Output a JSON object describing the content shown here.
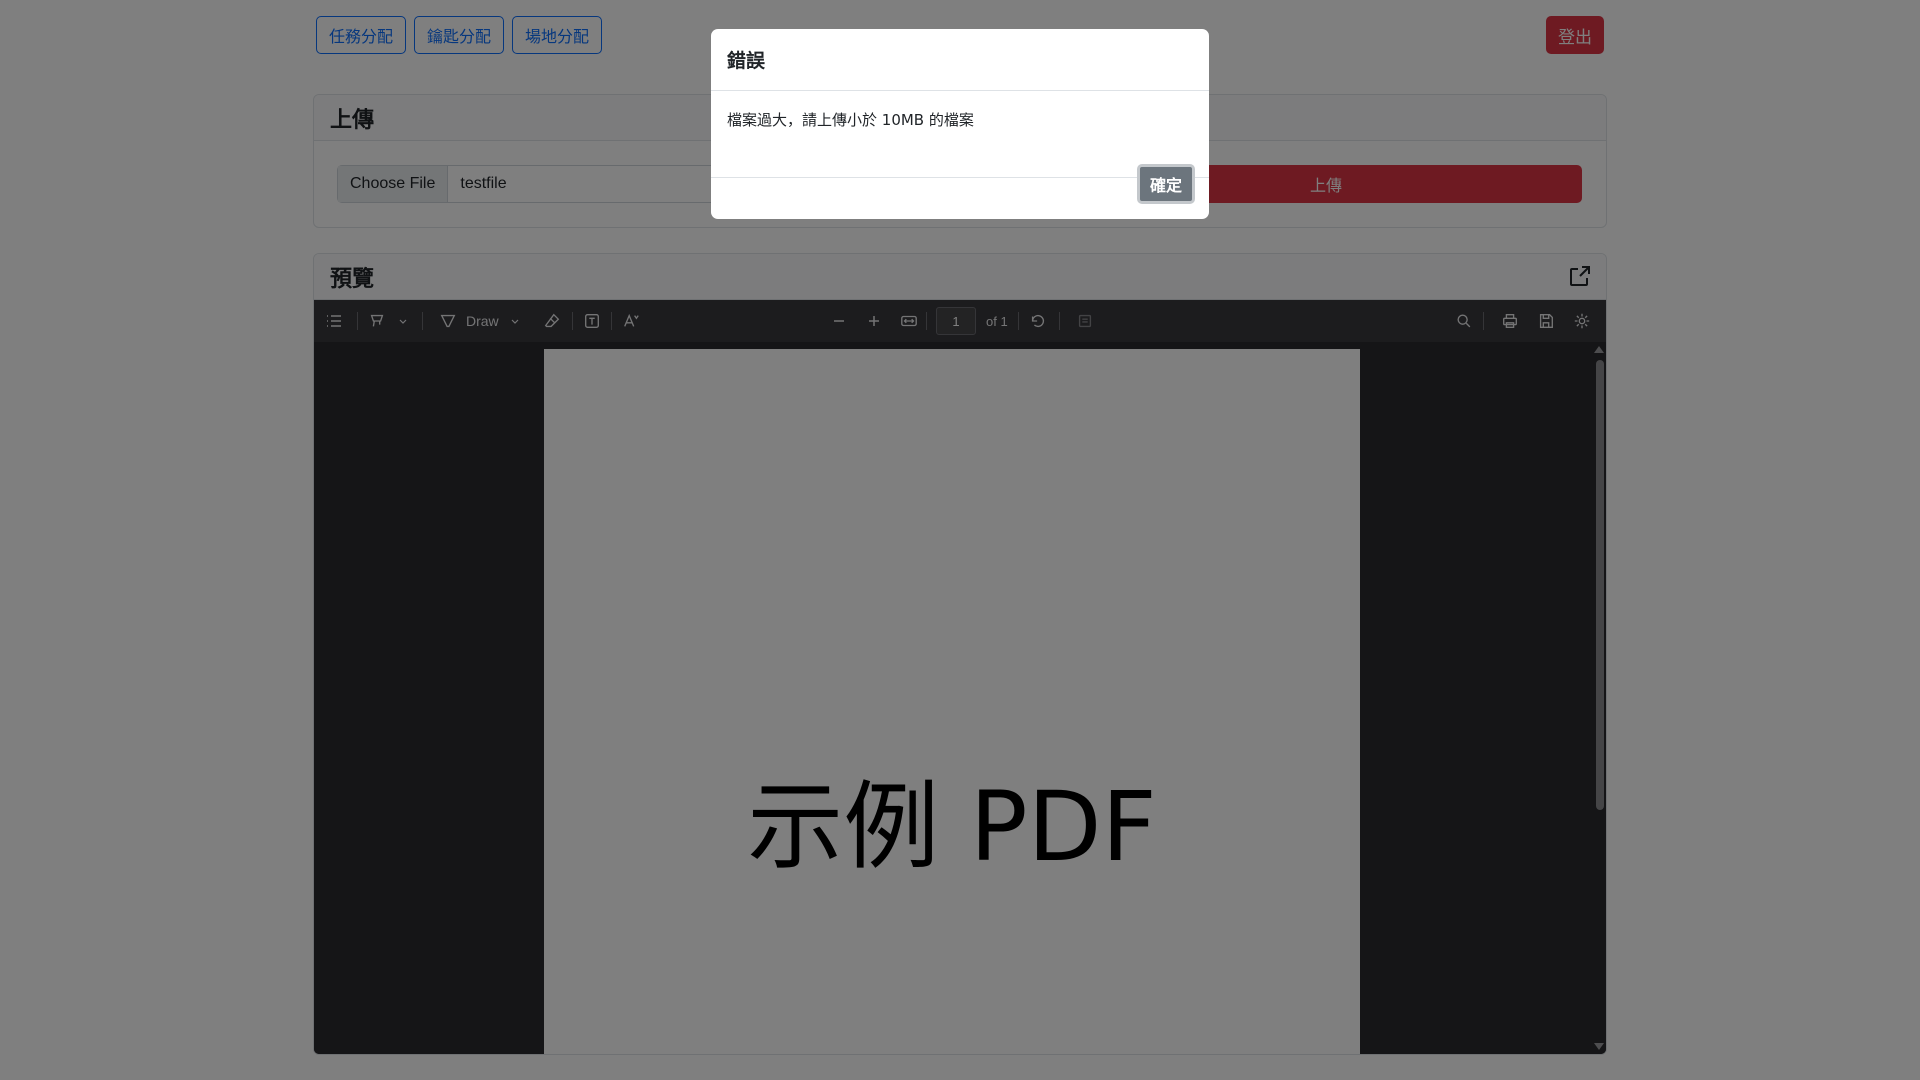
{
  "nav": {
    "items": [
      {
        "label": "任務分配"
      },
      {
        "label": "鑰匙分配"
      },
      {
        "label": "場地分配"
      }
    ],
    "logout_label": "登出"
  },
  "upload": {
    "title": "上傳",
    "choose_file_label": "Choose File",
    "file_name": "testfile",
    "submit_label": "上傳"
  },
  "preview": {
    "title": "預覽",
    "toolbar": {
      "draw_label": "Draw",
      "page_number": "1",
      "page_total": "of 1"
    },
    "pdf_text": "示例 PDF"
  },
  "modal": {
    "title": "錯誤",
    "message": "檔案過大，請上傳小於 10MB 的檔案",
    "confirm_label": "確定"
  },
  "colors": {
    "primary": "#0d6efd",
    "danger": "#dc3545",
    "secondary": "#6c757d"
  }
}
